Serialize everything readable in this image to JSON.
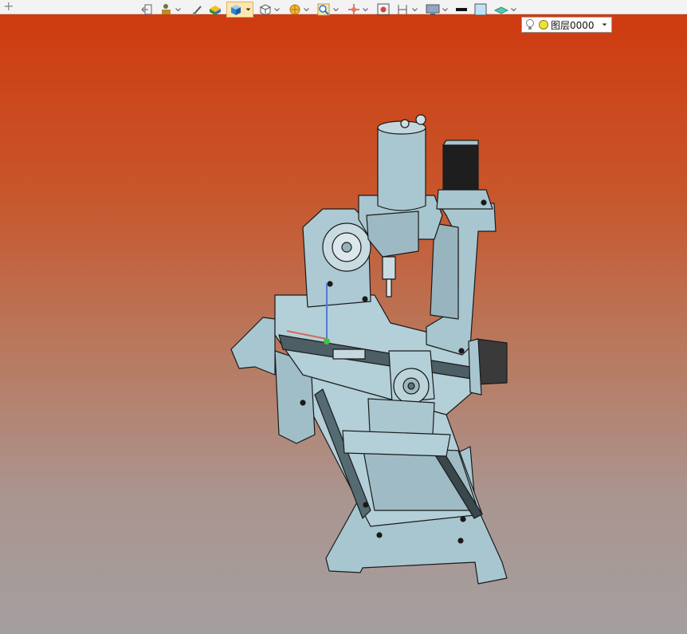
{
  "tabstrip": {
    "add_glyph": "+"
  },
  "toolbar": {
    "buttons": [
      {
        "name": "exit-sketch-icon"
      },
      {
        "name": "person-tools-icon"
      },
      {
        "name": "brush-icon"
      },
      {
        "name": "box-materials-icon"
      },
      {
        "name": "shaded-cube-icon"
      },
      {
        "name": "wire-cube-icon"
      },
      {
        "name": "section-icon"
      },
      {
        "name": "zoom-icon"
      },
      {
        "name": "move-axis-icon"
      },
      {
        "name": "fit-view-icon"
      },
      {
        "name": "dimension-icon"
      },
      {
        "name": "monitor-icon"
      },
      {
        "name": "line-color-icon"
      },
      {
        "name": "fill-color-icon"
      },
      {
        "name": "plane-icon"
      }
    ],
    "layer": {
      "value": "图层0000"
    }
  },
  "colors": {
    "part_fill": "#a8c6d0",
    "part_stroke": "#1a1a1a",
    "motor_dark": "#1e1e1e",
    "accent_active": "#fbe7b0"
  }
}
